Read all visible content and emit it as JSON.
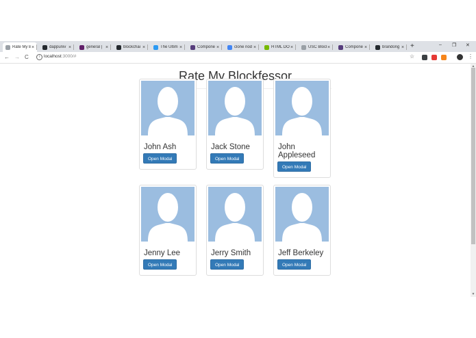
{
  "browser": {
    "tabs": [
      {
        "title": "Rate My B",
        "favicon": "page-icon",
        "color": "#9aa0a6",
        "active": true
      },
      {
        "title": "dappuniv",
        "favicon": "github-icon",
        "color": "#24292e"
      },
      {
        "title": "general | ",
        "favicon": "slack-icon",
        "color": "#611f69"
      },
      {
        "title": "blockchai",
        "favicon": "github-icon",
        "color": "#24292e"
      },
      {
        "title": "The Ultim",
        "favicon": "vs-icon",
        "color": "#2b9af3"
      },
      {
        "title": "Compone",
        "favicon": "bootstrap-icon",
        "color": "#563d7c"
      },
      {
        "title": "clone nod",
        "favicon": "google-icon",
        "color": "#4285f4"
      },
      {
        "title": "HTML DO",
        "favicon": "nvidia-icon",
        "color": "#76b900"
      },
      {
        "title": "USC Block",
        "favicon": "page-icon",
        "color": "#9aa0a6"
      },
      {
        "title": "Compone",
        "favicon": "bootstrap-icon",
        "color": "#563d7c"
      },
      {
        "title": "brandong",
        "favicon": "github-icon",
        "color": "#24292e"
      }
    ],
    "new_tab": "+",
    "url_host": "localhost",
    "url_rest": ":3000/#",
    "extensions": [
      {
        "icon": "extension-dark-icon",
        "color": "#3c4043"
      },
      {
        "icon": "opera-icon",
        "color": "#e53935"
      },
      {
        "icon": "metamask-icon",
        "color": "#f6851b"
      }
    ]
  },
  "page": {
    "title": "Rate My Blockfessor",
    "profiles": [
      {
        "name": "John Ash",
        "button": "Open Modal"
      },
      {
        "name": "Jack Stone",
        "button": "Open Modal"
      },
      {
        "name": "John Appleseed",
        "button": "Open Modal"
      },
      {
        "name": "Jenny Lee",
        "button": "Open Modal"
      },
      {
        "name": "Jerry Smith",
        "button": "Open Modal"
      },
      {
        "name": "Jeff Berkeley",
        "button": "Open Modal"
      }
    ]
  },
  "colors": {
    "avatar_bg": "#9bbde0",
    "button_bg": "#337ab7"
  }
}
